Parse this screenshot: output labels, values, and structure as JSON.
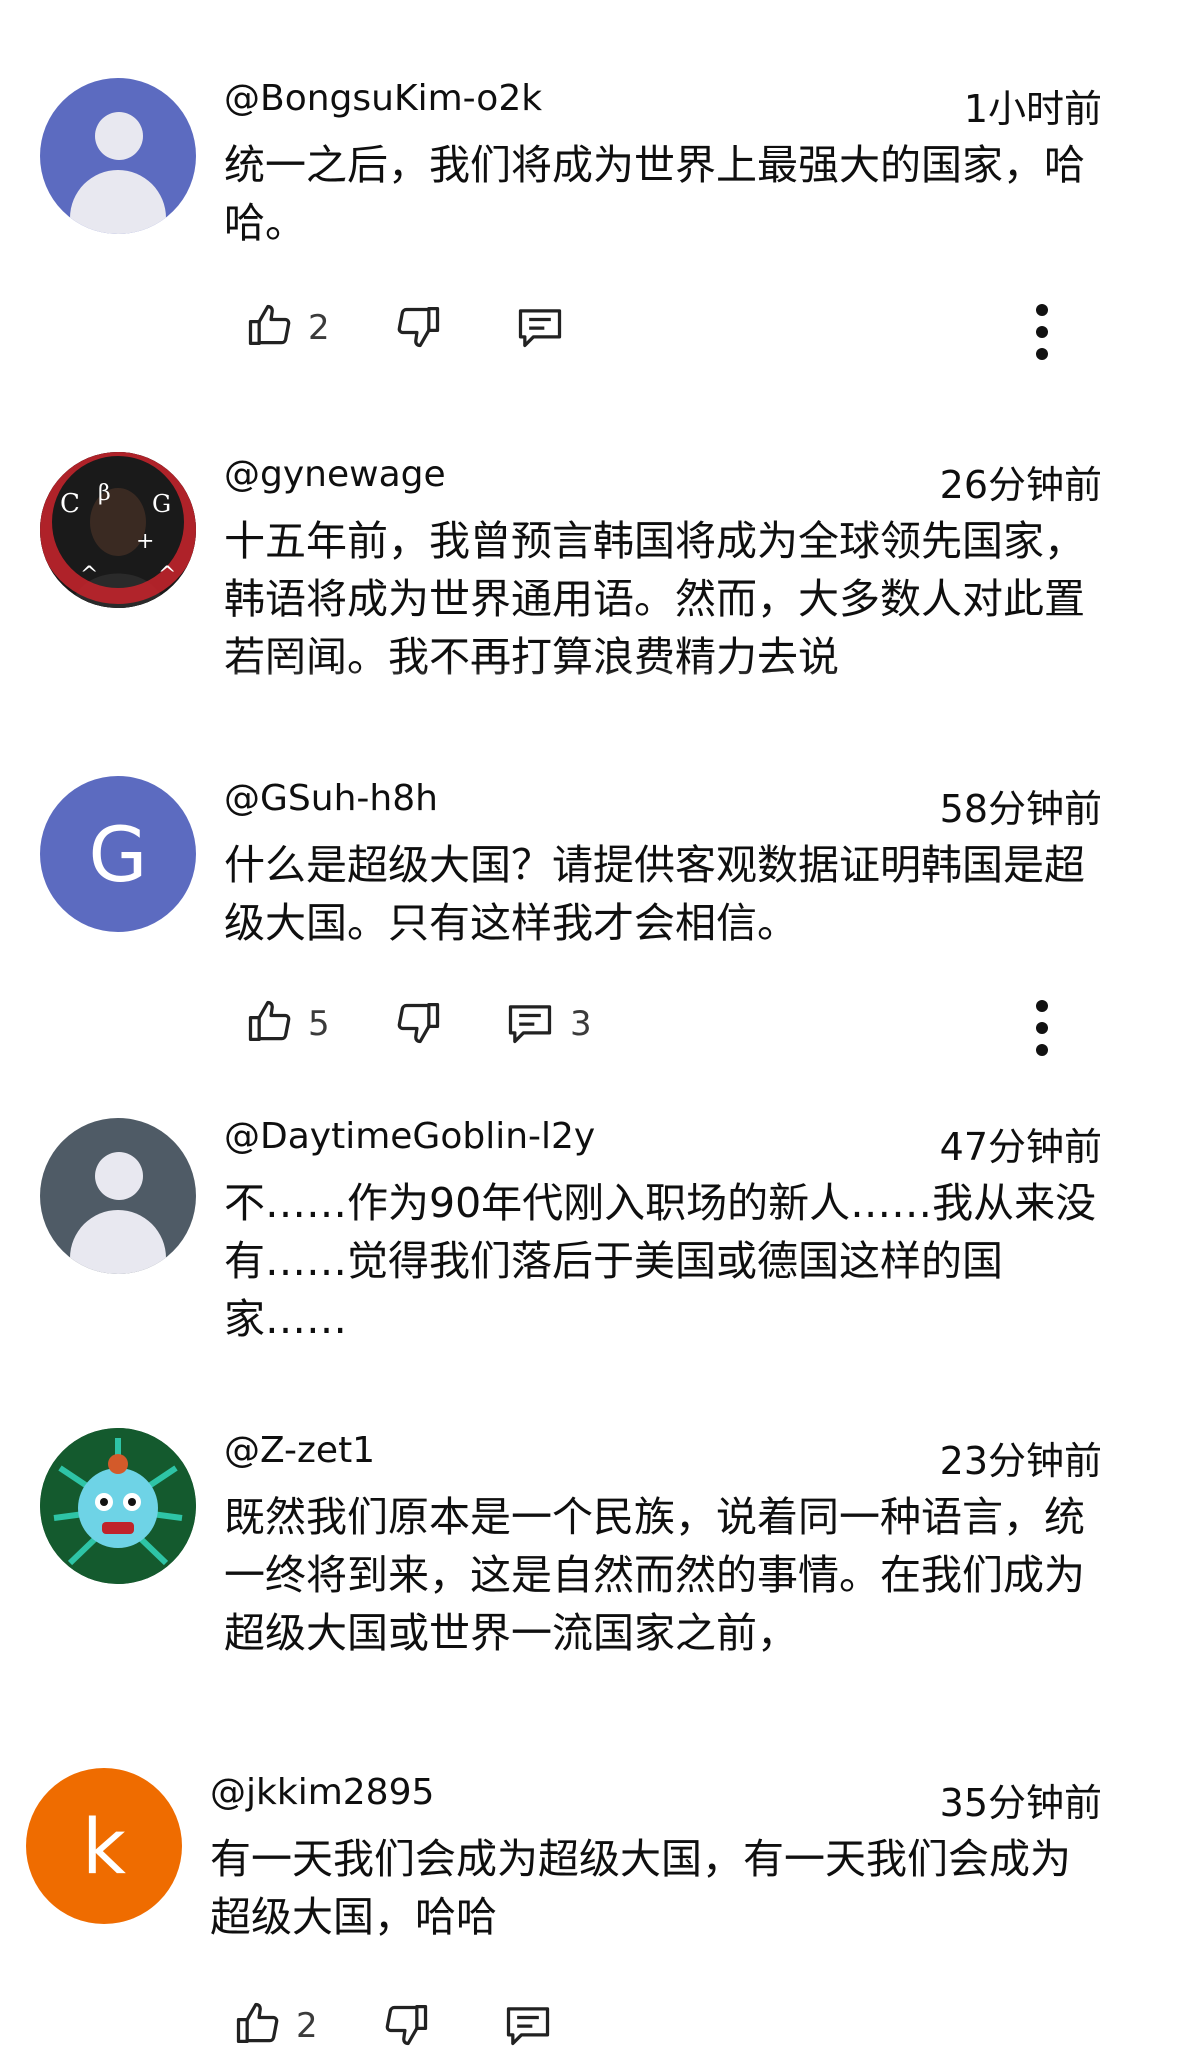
{
  "comments": [
    {
      "username": "@BongsuKim-o2k",
      "time": "1小时前",
      "text": "统一之后，我们将成为世界上最强大的国家，哈哈。",
      "likes": "2",
      "replies": "",
      "avatar": {
        "type": "default",
        "color": "#5c6bc0"
      }
    },
    {
      "username": "@gynewage",
      "time": "26分钟前",
      "text": "十五年前，我曾预言韩国将成为全球领先国家，韩语将成为世界通用语。然而，大多数人对此置若罔闻。我不再打算浪费精力去说",
      "avatar": {
        "type": "photo"
      }
    },
    {
      "username": "@GSuh-h8h",
      "time": "58分钟前",
      "text": "什么是超级大国？请提供客观数据证明韩国是超级大国。只有这样我才会相信。",
      "likes": "5",
      "replies": "3",
      "avatar": {
        "type": "letter",
        "letter": "G",
        "color": "#5c6bc0"
      }
    },
    {
      "username": "@DaytimeGoblin-l2y",
      "time": "47分钟前",
      "text": "不……作为90年代刚入职场的新人……我从来没有……觉得我们落后于美国或德国这样的国家……",
      "avatar": {
        "type": "default",
        "color": "#4f5b66"
      }
    },
    {
      "username": "@Z-zet1",
      "time": "23分钟前",
      "text": "既然我们原本是一个民族，说着同一种语言，统一终将到来，这是自然而然的事情。在我们成为超级大国或世界一流国家之前，",
      "avatar": {
        "type": "illustration"
      }
    },
    {
      "username": "@jkkim2895",
      "time": "35分钟前",
      "text": "有一天我们会成为超级大国，有一天我们会成为超级大国，哈哈",
      "likes": "2",
      "avatar": {
        "type": "letter",
        "letter": "k",
        "color": "#ef6c00"
      }
    }
  ],
  "icons": {
    "like": "thumbs-up-icon",
    "dislike": "thumbs-down-icon",
    "reply": "comment-icon",
    "more": "more-vertical-icon"
  }
}
